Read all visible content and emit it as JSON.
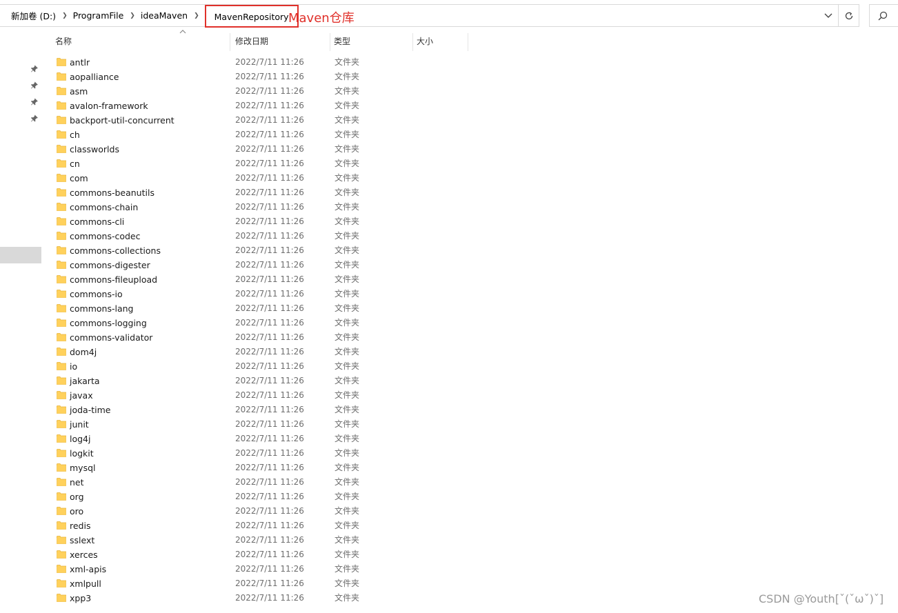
{
  "breadcrumb": {
    "items": [
      "新加卷 (D:)",
      "ProgramFile",
      "ideaMaven"
    ],
    "current": "MavenRepository"
  },
  "annotation": "Maven仓库",
  "columns": {
    "name": "名称",
    "date": "修改日期",
    "type": "类型",
    "size": "大小"
  },
  "folders": [
    {
      "name": "antlr",
      "date": "2022/7/11 11:26",
      "type": "文件夹"
    },
    {
      "name": "aopalliance",
      "date": "2022/7/11 11:26",
      "type": "文件夹"
    },
    {
      "name": "asm",
      "date": "2022/7/11 11:26",
      "type": "文件夹"
    },
    {
      "name": "avalon-framework",
      "date": "2022/7/11 11:26",
      "type": "文件夹"
    },
    {
      "name": "backport-util-concurrent",
      "date": "2022/7/11 11:26",
      "type": "文件夹"
    },
    {
      "name": "ch",
      "date": "2022/7/11 11:26",
      "type": "文件夹"
    },
    {
      "name": "classworlds",
      "date": "2022/7/11 11:26",
      "type": "文件夹"
    },
    {
      "name": "cn",
      "date": "2022/7/11 11:26",
      "type": "文件夹"
    },
    {
      "name": "com",
      "date": "2022/7/11 11:26",
      "type": "文件夹"
    },
    {
      "name": "commons-beanutils",
      "date": "2022/7/11 11:26",
      "type": "文件夹"
    },
    {
      "name": "commons-chain",
      "date": "2022/7/11 11:26",
      "type": "文件夹"
    },
    {
      "name": "commons-cli",
      "date": "2022/7/11 11:26",
      "type": "文件夹"
    },
    {
      "name": "commons-codec",
      "date": "2022/7/11 11:26",
      "type": "文件夹"
    },
    {
      "name": "commons-collections",
      "date": "2022/7/11 11:26",
      "type": "文件夹"
    },
    {
      "name": "commons-digester",
      "date": "2022/7/11 11:26",
      "type": "文件夹"
    },
    {
      "name": "commons-fileupload",
      "date": "2022/7/11 11:26",
      "type": "文件夹"
    },
    {
      "name": "commons-io",
      "date": "2022/7/11 11:26",
      "type": "文件夹"
    },
    {
      "name": "commons-lang",
      "date": "2022/7/11 11:26",
      "type": "文件夹"
    },
    {
      "name": "commons-logging",
      "date": "2022/7/11 11:26",
      "type": "文件夹"
    },
    {
      "name": "commons-validator",
      "date": "2022/7/11 11:26",
      "type": "文件夹"
    },
    {
      "name": "dom4j",
      "date": "2022/7/11 11:26",
      "type": "文件夹"
    },
    {
      "name": "io",
      "date": "2022/7/11 11:26",
      "type": "文件夹"
    },
    {
      "name": "jakarta",
      "date": "2022/7/11 11:26",
      "type": "文件夹"
    },
    {
      "name": "javax",
      "date": "2022/7/11 11:26",
      "type": "文件夹"
    },
    {
      "name": "joda-time",
      "date": "2022/7/11 11:26",
      "type": "文件夹"
    },
    {
      "name": "junit",
      "date": "2022/7/11 11:26",
      "type": "文件夹"
    },
    {
      "name": "log4j",
      "date": "2022/7/11 11:26",
      "type": "文件夹"
    },
    {
      "name": "logkit",
      "date": "2022/7/11 11:26",
      "type": "文件夹"
    },
    {
      "name": "mysql",
      "date": "2022/7/11 11:26",
      "type": "文件夹"
    },
    {
      "name": "net",
      "date": "2022/7/11 11:26",
      "type": "文件夹"
    },
    {
      "name": "org",
      "date": "2022/7/11 11:26",
      "type": "文件夹"
    },
    {
      "name": "oro",
      "date": "2022/7/11 11:26",
      "type": "文件夹"
    },
    {
      "name": "redis",
      "date": "2022/7/11 11:26",
      "type": "文件夹"
    },
    {
      "name": "sslext",
      "date": "2022/7/11 11:26",
      "type": "文件夹"
    },
    {
      "name": "xerces",
      "date": "2022/7/11 11:26",
      "type": "文件夹"
    },
    {
      "name": "xml-apis",
      "date": "2022/7/11 11:26",
      "type": "文件夹"
    },
    {
      "name": "xmlpull",
      "date": "2022/7/11 11:26",
      "type": "文件夹"
    },
    {
      "name": "xpp3",
      "date": "2022/7/11 11:26",
      "type": "文件夹"
    }
  ],
  "watermark": "CSDN @Youth[ˇ(ˇωˇ)ˇ]",
  "colors": {
    "highlight": "#e0302a",
    "folder": "#ffd15c",
    "folder_dark": "#e8b339"
  },
  "icons": [
    "chevron-right-icon",
    "chevron-down-icon",
    "refresh-icon",
    "search-icon",
    "pin-icon",
    "folder-icon"
  ]
}
